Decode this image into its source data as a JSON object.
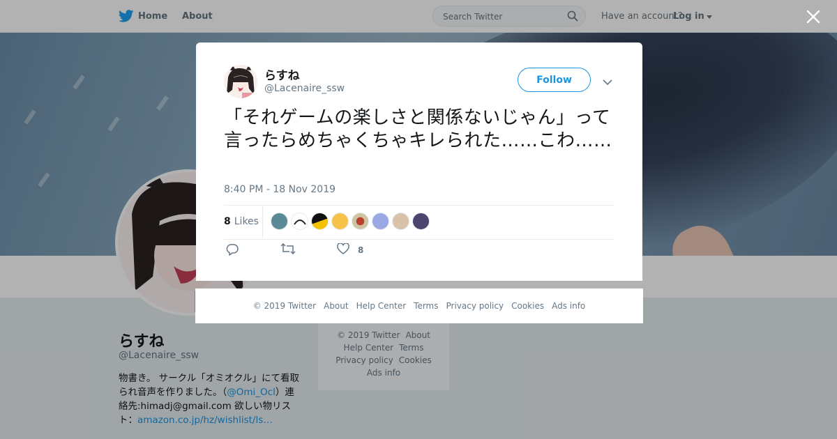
{
  "topnav": {
    "home_label": "Home",
    "about_label": "About",
    "search_placeholder": "Search Twitter",
    "have_account": "Have an account?",
    "login_label": "Log in"
  },
  "profile": {
    "name": "らすね",
    "handle": "@Lacenaire_ssw",
    "bio_1": "物書き。 サークル「オミオクル」にて看取られ音声を作りました。（",
    "bio_link_omi": "@Omi_Ocl",
    "bio_2": "）連絡先:himadj@gmail.com 欲しい物リスト：",
    "bio_link_amazon": "amazon.co.jp/hz/wishlist/ls…"
  },
  "mini_footer": {
    "copyright": "© 2019 Twitter",
    "about": "About",
    "help": "Help Center",
    "terms": "Terms",
    "privacy": "Privacy policy",
    "cookies": "Cookies",
    "ads": "Ads info"
  },
  "tweet": {
    "name": "らすね",
    "handle": "@Lacenaire_ssw",
    "follow_label": "Follow",
    "text": "「それゲームの楽しさと関係ないじゃん」って言ったらめちゃくちゃキレられた……こわ……",
    "timestamp": "8:40 PM - 18 Nov 2019",
    "likes_count": "8",
    "likes_label": "Likes",
    "like_action_count": "8"
  },
  "modal_footer": {
    "copyright": "© 2019 Twitter",
    "about": "About",
    "help": "Help Center",
    "terms": "Terms",
    "privacy": "Privacy policy",
    "cookies": "Cookies",
    "ads": "Ads info"
  },
  "colors": {
    "accent": "#1b95e0",
    "twitter_blue": "#1da1f2",
    "muted_text": "#657786",
    "background": "#e6ecf0"
  },
  "icons": [
    "twitter-bird-icon",
    "home-icon",
    "search-icon",
    "close-icon",
    "chevron-down-icon",
    "reply-icon",
    "retweet-icon",
    "heart-icon"
  ]
}
